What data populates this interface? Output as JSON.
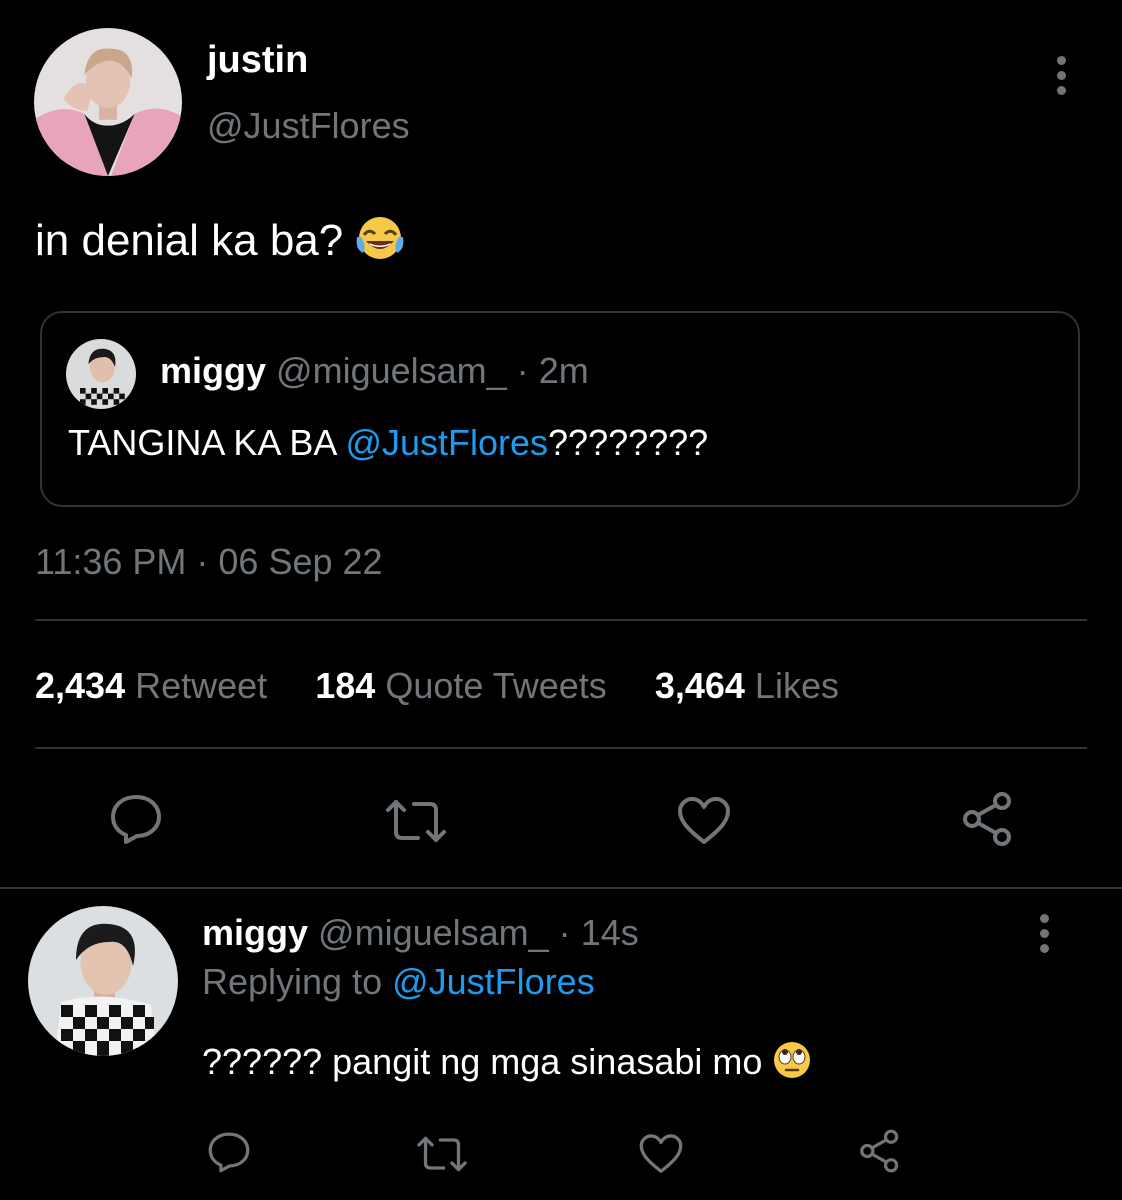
{
  "tweet": {
    "author_name": "justin",
    "author_handle": "@JustFlores",
    "text": "in denial ka ba?",
    "text_emoji": "face-with-tears-of-joy-icon",
    "quoted": {
      "author_name": "miggy",
      "author_handle": "@miguelsam_",
      "separator": "·",
      "time": "2m",
      "text_prefix": "TANGINA KA BA ",
      "mention": "@JustFlores",
      "text_suffix": "????????"
    },
    "timestamp": "11:36 PM · 06 Sep 22",
    "stats": {
      "retweets_count": "2,434",
      "retweets_label": "Retweet",
      "quotes_count": "184",
      "quotes_label": "Quote Tweets",
      "likes_count": "3,464",
      "likes_label": "Likes"
    }
  },
  "reply": {
    "author_name": "miggy",
    "author_handle": "@miguelsam_",
    "separator": "·",
    "time": "14s",
    "replying_prefix": "Replying to ",
    "replying_to": "@JustFlores",
    "text": "?????? pangit ng mga sinasabi mo",
    "text_emoji": "face-with-rolling-eyes-icon"
  },
  "icons": [
    "reply-icon",
    "retweet-icon",
    "like-icon",
    "share-icon",
    "more-options-icon"
  ],
  "colors": {
    "background": "#000000",
    "text": "#e7e9ea",
    "muted": "#71767b",
    "link": "#1d9bf0",
    "border": "#2f3336",
    "avatar_pink": "#e8a4b8"
  }
}
